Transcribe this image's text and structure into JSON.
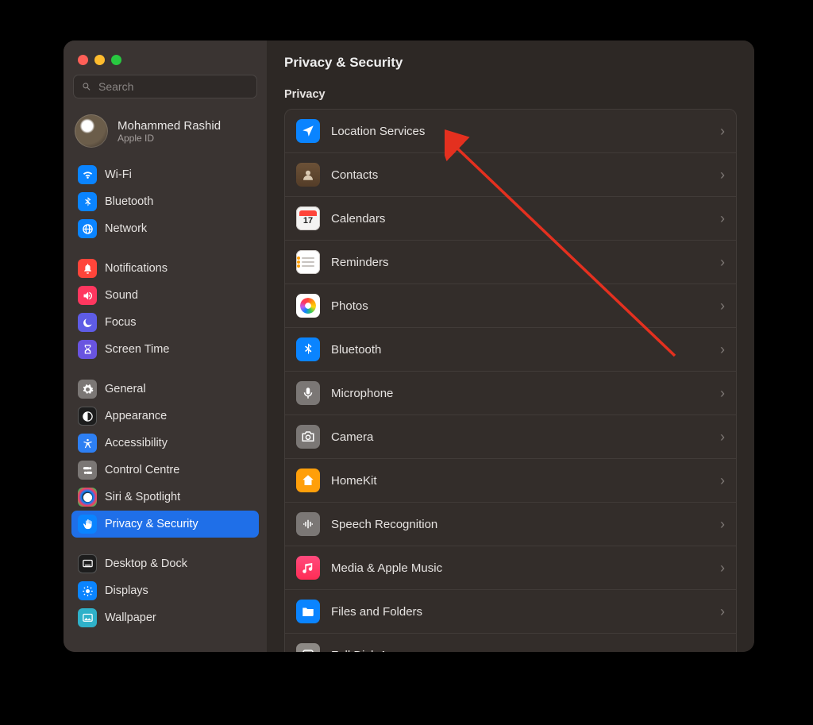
{
  "search": {
    "placeholder": "Search"
  },
  "profile": {
    "name": "Mohammed Rashid",
    "sub": "Apple ID"
  },
  "sidebar": {
    "groups": [
      [
        {
          "label": "Wi-Fi",
          "icon": "wifi",
          "bg": "bg-blue"
        },
        {
          "label": "Bluetooth",
          "icon": "bluetooth",
          "bg": "bg-blue"
        },
        {
          "label": "Network",
          "icon": "globe",
          "bg": "bg-blue"
        }
      ],
      [
        {
          "label": "Notifications",
          "icon": "bell",
          "bg": "bg-red"
        },
        {
          "label": "Sound",
          "icon": "speaker",
          "bg": "bg-pink"
        },
        {
          "label": "Focus",
          "icon": "moon",
          "bg": "bg-purple"
        },
        {
          "label": "Screen Time",
          "icon": "hourglass",
          "bg": "bg-indigo"
        }
      ],
      [
        {
          "label": "General",
          "icon": "gear",
          "bg": "bg-gray"
        },
        {
          "label": "Appearance",
          "icon": "appearance",
          "bg": "bg-black"
        },
        {
          "label": "Accessibility",
          "icon": "accessibility",
          "bg": "bg-blue2"
        },
        {
          "label": "Control Centre",
          "icon": "switches",
          "bg": "bg-gray"
        },
        {
          "label": "Siri & Spotlight",
          "icon": "siri",
          "bg": "bg-siri"
        },
        {
          "label": "Privacy & Security",
          "icon": "hand",
          "bg": "bg-blue",
          "selected": true
        }
      ],
      [
        {
          "label": "Desktop & Dock",
          "icon": "dock",
          "bg": "bg-black"
        },
        {
          "label": "Displays",
          "icon": "sun",
          "bg": "bg-blue"
        },
        {
          "label": "Wallpaper",
          "icon": "wallpaper",
          "bg": "bg-teal"
        }
      ]
    ]
  },
  "main": {
    "title": "Privacy & Security",
    "section": "Privacy",
    "calendar_day": "17",
    "rows": [
      {
        "label": "Location Services",
        "icon": "location",
        "cls": "ai-blue"
      },
      {
        "label": "Contacts",
        "icon": "contacts",
        "cls": "ai-brown"
      },
      {
        "label": "Calendars",
        "icon": "calendar",
        "cls": "ai-white ai-calendar"
      },
      {
        "label": "Reminders",
        "icon": "reminders",
        "cls": "ai-rem"
      },
      {
        "label": "Photos",
        "icon": "photos",
        "cls": "ai-photos"
      },
      {
        "label": "Bluetooth",
        "icon": "bluetooth",
        "cls": "ai-blue"
      },
      {
        "label": "Microphone",
        "icon": "mic",
        "cls": "ai-gray"
      },
      {
        "label": "Camera",
        "icon": "camera",
        "cls": "ai-gray"
      },
      {
        "label": "HomeKit",
        "icon": "home",
        "cls": "ai-orange"
      },
      {
        "label": "Speech Recognition",
        "icon": "waveform",
        "cls": "ai-gray"
      },
      {
        "label": "Media & Apple Music",
        "icon": "music",
        "cls": "ai-pink"
      },
      {
        "label": "Files and Folders",
        "icon": "folder",
        "cls": "ai-folder"
      },
      {
        "label": "Full Disk Access",
        "icon": "disk",
        "cls": "ai-disk"
      }
    ]
  }
}
